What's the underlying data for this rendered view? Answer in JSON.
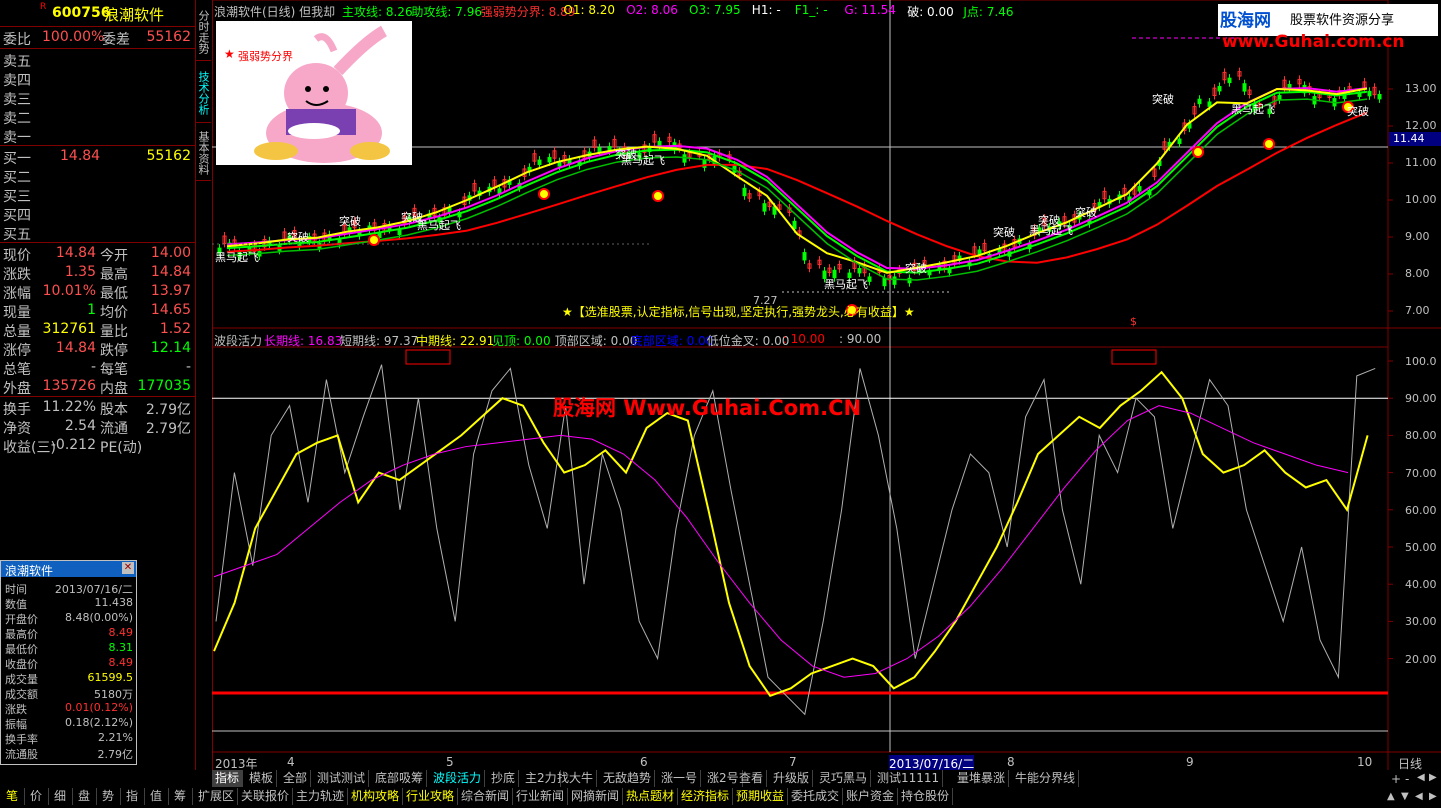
{
  "stock": {
    "code": "600756",
    "name": "浪潮软件",
    "r_mark": "R"
  },
  "quote": {
    "weibi_label": "委比",
    "weibi": "100.00%",
    "weicha_label": "委差",
    "weicha": "55162",
    "sell": [
      {
        "label": "卖五",
        "price": "",
        "vol": ""
      },
      {
        "label": "卖四",
        "price": "",
        "vol": ""
      },
      {
        "label": "卖三",
        "price": "",
        "vol": ""
      },
      {
        "label": "卖二",
        "price": "",
        "vol": ""
      },
      {
        "label": "卖一",
        "price": "",
        "vol": ""
      }
    ],
    "buy": [
      {
        "label": "买一",
        "price": "14.84",
        "vol": "55162"
      },
      {
        "label": "买二",
        "price": "",
        "vol": ""
      },
      {
        "label": "买三",
        "price": "",
        "vol": ""
      },
      {
        "label": "买四",
        "price": "",
        "vol": ""
      },
      {
        "label": "买五",
        "price": "",
        "vol": ""
      }
    ],
    "stats": [
      {
        "l1": "现价",
        "v1": "14.84",
        "c1": "cr",
        "l2": "今开",
        "v2": "14.00",
        "c2": "cr"
      },
      {
        "l1": "涨跌",
        "v1": "1.35",
        "c1": "cr",
        "l2": "最高",
        "v2": "14.84",
        "c2": "cr"
      },
      {
        "l1": "涨幅",
        "v1": "10.01%",
        "c1": "cr",
        "l2": "最低",
        "v2": "13.97",
        "c2": "cr"
      },
      {
        "l1": "现量",
        "v1": "1",
        "c1": "cg",
        "l2": "均价",
        "v2": "14.65",
        "c2": "cr"
      },
      {
        "l1": "总量",
        "v1": "312761",
        "c1": "cy",
        "l2": "量比",
        "v2": "1.52",
        "c2": "cr"
      },
      {
        "l1": "涨停",
        "v1": "14.84",
        "c1": "cr",
        "l2": "跌停",
        "v2": "12.14",
        "c2": "cg"
      },
      {
        "l1": "总笔",
        "v1": "-",
        "c1": "cw",
        "l2": "每笔",
        "v2": "-",
        "c2": "cw"
      },
      {
        "l1": "外盘",
        "v1": "135726",
        "c1": "cr",
        "l2": "内盘",
        "v2": "177035",
        "c2": "cg"
      }
    ],
    "stats2": [
      {
        "l1": "换手",
        "v1": "11.22%",
        "l2": "股本",
        "v2": "2.79亿"
      },
      {
        "l1": "净资",
        "v1": "2.54",
        "l2": "流通",
        "v2": "2.79亿"
      },
      {
        "l1": "收益(三)",
        "v1": "-0.212",
        "l2": "PE(动)",
        "v2": ""
      }
    ]
  },
  "side_tabs": [
    "分时走势",
    "技术分析",
    "基本资料"
  ],
  "main_chart": {
    "title": "浪潮软件(日线) 但我却",
    "indicators": [
      {
        "t": "主攻线: 8.26",
        "c": "#00ff00"
      },
      {
        "t": "助攻线: 7.96",
        "c": "#00ff00"
      },
      {
        "t": "强弱势分界: 8.89",
        "c": "#ff3030"
      },
      {
        "t": "O1: 8.20",
        "c": "#ffff00"
      },
      {
        "t": "O2: 8.06",
        "c": "#ff00ff"
      },
      {
        "t": "O3: 7.95",
        "c": "#00ff00"
      },
      {
        "t": "H1: -",
        "c": "#ffffff"
      },
      {
        "t": "F1_: -",
        "c": "#00ff00"
      },
      {
        "t": "G: 11.54",
        "c": "#ff00ff"
      },
      {
        "t": "破: 0.00",
        "c": "#ffffff"
      },
      {
        "t": "J点: 7.46",
        "c": "#00ff00"
      }
    ],
    "y_ticks": [
      "13.00",
      "12.00",
      "11.00",
      "10.00",
      "9.00",
      "8.00",
      "7.00"
    ],
    "current_price_tag": "11.44",
    "legend_box": "强弱势分界",
    "low_label": "7.27",
    "notice": "★【选准股票,认定指标,信号出现,坚定执行,强势龙头,必有收益】★",
    "annotations": [
      {
        "t": "黑马起飞",
        "x": 3,
        "y": 249
      },
      {
        "t": "突破",
        "x": 75,
        "y": 229
      },
      {
        "t": "突破",
        "x": 127,
        "y": 213
      },
      {
        "t": "黑马起飞",
        "x": 205,
        "y": 217
      },
      {
        "t": "突破",
        "x": 189,
        "y": 209
      },
      {
        "t": "黑马起飞",
        "x": 409,
        "y": 152
      },
      {
        "t": "突破",
        "x": 403,
        "y": 146
      },
      {
        "t": "黑马起飞",
        "x": 612,
        "y": 276
      },
      {
        "t": "突破",
        "x": 693,
        "y": 260
      },
      {
        "t": "突破",
        "x": 781,
        "y": 224
      },
      {
        "t": "黑马起飞",
        "x": 817,
        "y": 222
      },
      {
        "t": "突破",
        "x": 826,
        "y": 212
      },
      {
        "t": "突破",
        "x": 863,
        "y": 204
      },
      {
        "t": "突破",
        "x": 940,
        "y": 91
      },
      {
        "t": "黑马起飞",
        "x": 1019,
        "y": 101
      },
      {
        "t": "突破",
        "x": 1135,
        "y": 103
      }
    ],
    "dollar": "$"
  },
  "sub_chart": {
    "title": "波段活力",
    "indicators": [
      {
        "t": "长期线: 16.83",
        "c": "#ff00ff"
      },
      {
        "t": "短期线: 97.37",
        "c": "#c0c0c0"
      },
      {
        "t": "中期线: 22.91",
        "c": "#ffff00"
      },
      {
        "t": "见顶: 0.00",
        "c": "#00ff00"
      },
      {
        "t": "顶部区域: 0.00",
        "c": "#c0c0c0"
      },
      {
        "t": "底部区域: 0.00",
        "c": "#0000ff"
      },
      {
        "t": "低位金叉: 0.00",
        "c": "#c0c0c0"
      },
      {
        "t": ": 10.00",
        "c": "#ff0000"
      },
      {
        "t": ": 90.00",
        "c": "#c0c0c0"
      }
    ],
    "y_ticks": [
      "100.0",
      "90.00",
      "80.00",
      "70.00",
      "60.00",
      "50.00",
      "40.00",
      "30.00",
      "20.00"
    ],
    "watermark": "股海网 Www.Guhai.Com.CN"
  },
  "x_axis": {
    "labels": [
      "2013年",
      "4",
      "5",
      "6",
      "7",
      "2013/07/16/二",
      "8",
      "9",
      "10"
    ],
    "period": "日线"
  },
  "logo": {
    "brand": "股海网",
    "tagline": "股票软件资源分享",
    "url": "www.Guhai.com.cn"
  },
  "infobox": {
    "title": "浪潮软件",
    "rows": [
      {
        "k": "时间",
        "v": "2013/07/16/二",
        "c": "#c0c0c0"
      },
      {
        "k": "数值",
        "v": "11.438",
        "c": "#c0c0c0"
      },
      {
        "k": "开盘价",
        "v": "8.48(0.00%)",
        "c": "#c0c0c0"
      },
      {
        "k": "最高价",
        "v": "8.49",
        "c": "#ff3030"
      },
      {
        "k": "最低价",
        "v": "8.31",
        "c": "#00ff00"
      },
      {
        "k": "收盘价",
        "v": "8.49",
        "c": "#ff3030"
      },
      {
        "k": "成交量",
        "v": "61599.5",
        "c": "#ffff00"
      },
      {
        "k": "成交额",
        "v": "5180万",
        "c": "#c0c0c0"
      },
      {
        "k": "涨跌",
        "v": "0.01(0.12%)",
        "c": "#ff3030"
      },
      {
        "k": "振幅",
        "v": "0.18(2.12%)",
        "c": "#c0c0c0"
      },
      {
        "k": "换手率",
        "v": "2.21%",
        "c": "#c0c0c0"
      },
      {
        "k": "流通股",
        "v": "2.79亿",
        "c": "#c0c0c0"
      }
    ]
  },
  "tabs_row1": [
    {
      "t": "指标",
      "c": "#ffffff",
      "active": true
    },
    {
      "t": "模板",
      "c": "#c0c0c0"
    },
    {
      "t": "全部",
      "c": "#c0c0c0"
    },
    {
      "t": "测试测试",
      "c": "#c0c0c0"
    },
    {
      "t": "底部吸筹",
      "c": "#c0c0c0"
    },
    {
      "t": "波段活力",
      "c": "#00ffff"
    },
    {
      "t": "抄底",
      "c": "#c0c0c0"
    },
    {
      "t": "主2力",
      "c": "#c0c0c0"
    },
    {
      "t": "找大牛",
      "c": "#c0c0c0"
    },
    {
      "t": "无敌趋势",
      "c": "#c0c0c0"
    },
    {
      "t": "涨一号",
      "c": "#c0c0c0"
    },
    {
      "t": "涨2号",
      "c": "#c0c0c0"
    },
    {
      "t": "查看",
      "c": "#c0c0c0"
    },
    {
      "t": "升级版",
      "c": "#c0c0c0"
    },
    {
      "t": "灵巧黑马",
      "c": "#c0c0c0"
    },
    {
      "t": "测试11111",
      "c": "#c0c0c0"
    },
    {
      "t": "量堆暴涨",
      "c": "#c0c0c0"
    },
    {
      "t": "牛能分界线",
      "c": "#c0c0c0"
    }
  ],
  "tabs_row2_left": [
    "笔",
    "价",
    "细",
    "盘",
    "势",
    "指",
    "值",
    "筹"
  ],
  "tabs_row2": [
    {
      "t": "扩展区",
      "c": "#c0c0c0"
    },
    {
      "t": "关联报价",
      "c": "#c0c0c0"
    },
    {
      "t": "主力轨迹",
      "c": "#c0c0c0"
    },
    {
      "t": "机构攻略",
      "c": "#ffff00"
    },
    {
      "t": "行业攻略",
      "c": "#ffff00"
    },
    {
      "t": "综合新闻",
      "c": "#c0c0c0"
    },
    {
      "t": "行业新闻",
      "c": "#c0c0c0"
    },
    {
      "t": "网摘新闻",
      "c": "#c0c0c0"
    },
    {
      "t": "热点题材",
      "c": "#ffff00"
    },
    {
      "t": "经济指标",
      "c": "#ffff00"
    },
    {
      "t": "预期收益",
      "c": "#ffff00"
    },
    {
      "t": "委托成交",
      "c": "#c0c0c0"
    },
    {
      "t": "账户资金",
      "c": "#c0c0c0"
    },
    {
      "t": "持仓股份",
      "c": "#c0c0c0"
    }
  ],
  "colors": {
    "up": "#ff3030",
    "down": "#00ff00",
    "grid": "#800000",
    "ma_red": "#ff0000",
    "ma_yellow": "#ffff00",
    "ma_magenta": "#ff00ff"
  }
}
